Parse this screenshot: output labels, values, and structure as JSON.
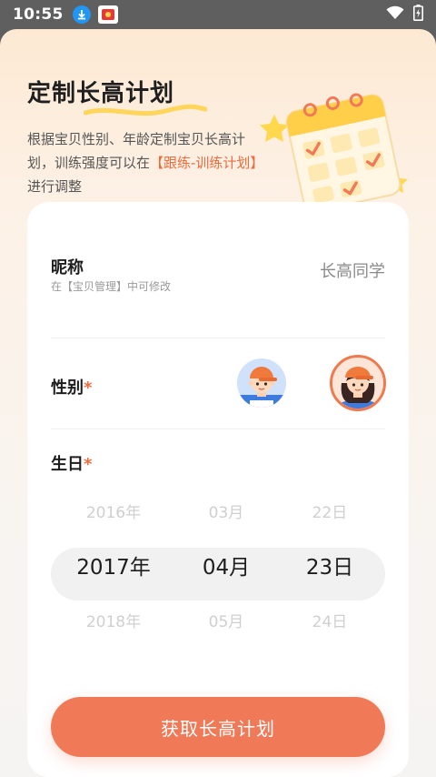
{
  "status_bar": {
    "time": "10:55",
    "icons": [
      "download-icon",
      "app-notification-icon",
      "wifi-icon",
      "battery-charging-icon"
    ]
  },
  "header": {
    "title": "定制长高计划",
    "subtitle_pre": "根据宝贝性别、年龄定制宝贝长高计划，训练强度可以在",
    "subtitle_link": "【跟练-训练计划】",
    "subtitle_post": "进行调整"
  },
  "form": {
    "nickname": {
      "label": "昵称",
      "hint": "在【宝贝管理】中可修改",
      "value": "长高同学"
    },
    "gender": {
      "label": "性别",
      "required_mark": "*",
      "options": [
        "boy-avatar",
        "girl-avatar"
      ],
      "selected": "girl-avatar"
    },
    "birthday": {
      "label": "生日",
      "required_mark": "*",
      "year_prev": "2016年",
      "year": "2017年",
      "year_next": "2018年",
      "month_prev": "03月",
      "month": "04月",
      "month_next": "05月",
      "day_prev": "22日",
      "day": "23日",
      "day_next": "24日"
    }
  },
  "cta": {
    "label": "获取长高计划"
  },
  "colors": {
    "accent": "#f07a57",
    "required": "#f06a3c",
    "status_bar": "#5f5f5f"
  }
}
